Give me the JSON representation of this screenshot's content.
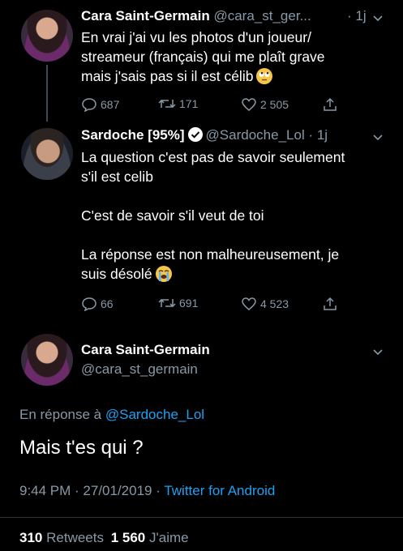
{
  "tweets": [
    {
      "name": "Cara Saint-Germain",
      "handle": "@cara_st_ger...",
      "time": "· 1j",
      "text": [
        "En vrai j'ai vu les photos d'un joueur/",
        "streameur (français) qui me plaît grave",
        "mais j'sais pas si il est célib"
      ],
      "emoji": "rolling-eyes-emoji",
      "replies": "687",
      "retweets": "171",
      "likes": "2 505"
    },
    {
      "name": "Sardoche [95%]",
      "handle": "@Sardoche_Lol",
      "time": "· 1j",
      "text": [
        "La question c'est pas de savoir seulement",
        "s'il est celib",
        "",
        "C'est de savoir s'il veut de toi",
        "",
        "La réponse est non malheureusement, je",
        "suis désolé"
      ],
      "emoji": "crying-face-emoji",
      "replies": "66",
      "retweets": "691",
      "likes": "4 523"
    }
  ],
  "main_tweet": {
    "name": "Cara Saint-Germain",
    "handle": "@cara_st_germain",
    "reply_prefix": "En réponse à",
    "reply_to": "@Sardoche_Lol",
    "text": "Mais t'es qui ?",
    "timestamp": "9:44 PM · 27/01/2019 ·",
    "client": "Twitter for Android",
    "retweets_count": "310",
    "retweets_label": "Retweets",
    "likes_count": "1 560",
    "likes_label": "J'aime"
  },
  "colors": {
    "background": "#000000",
    "muted": "#8899a6",
    "link": "#1da1f2",
    "divider": "#2f3336"
  }
}
